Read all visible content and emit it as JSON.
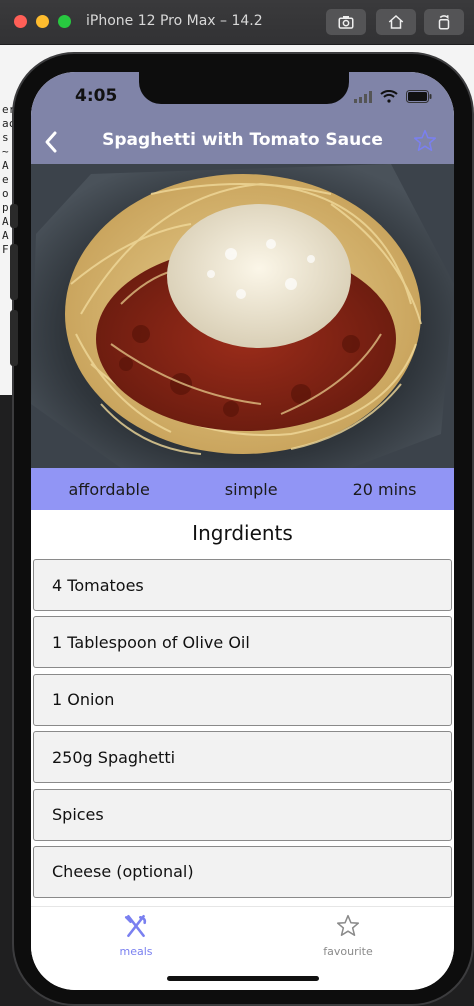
{
  "simulator": {
    "window_title": "iPhone 12 Pro Max – 14.2",
    "terminal_lines": [
      "eract",
      "ac",
      "s",
      "~",
      "A",
      "e",
      "o",
      "p",
      "A",
      "A",
      "F"
    ]
  },
  "status": {
    "time": "4:05"
  },
  "appbar": {
    "title": "Spaghetti with Tomato Sauce",
    "color": "#8084a8",
    "accent": "#7a80f0"
  },
  "meta": {
    "affordability": "affordable",
    "complexity": "simple",
    "duration": "20 mins",
    "bar_color": "#9195f5"
  },
  "ingredients_title": "Ingrdients",
  "ingredients": [
    "4 Tomatoes",
    "1 Tablespoon of Olive Oil",
    "1 Onion",
    "250g Spaghetti",
    "Spices",
    "Cheese (optional)"
  ],
  "tabs": {
    "meals": {
      "label": "meals",
      "icon": "fork-knife-icon",
      "active": true
    },
    "favourite": {
      "label": "favourite",
      "icon": "star-outline-icon",
      "active": false
    }
  }
}
